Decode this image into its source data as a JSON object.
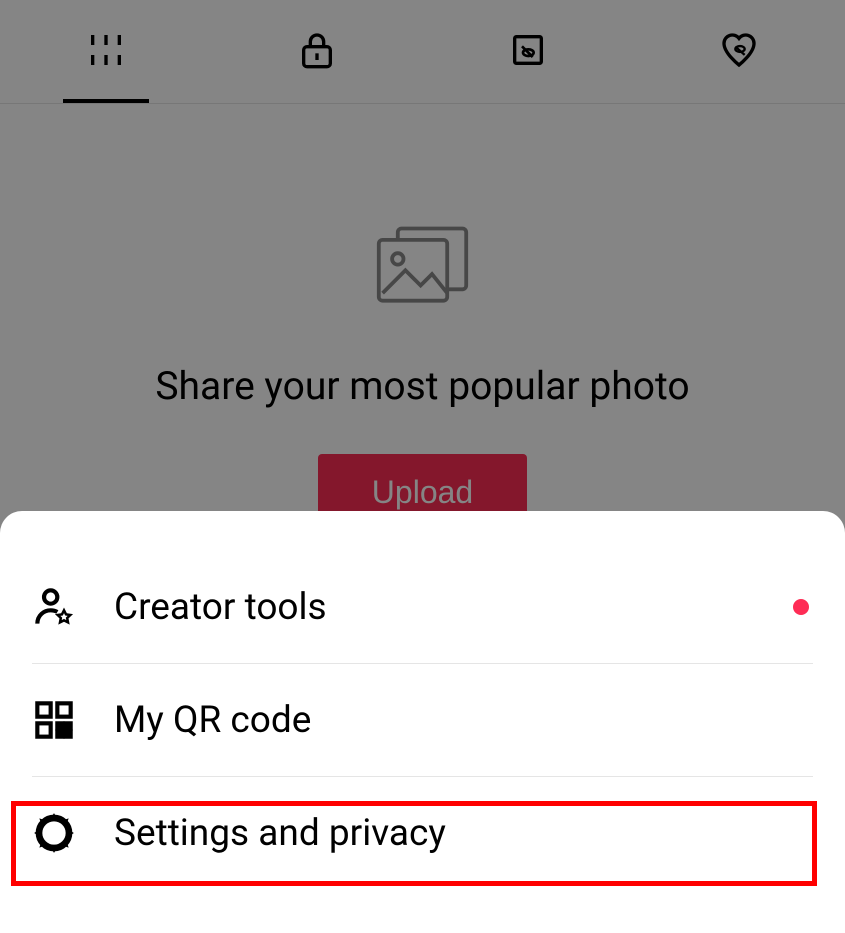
{
  "tabs": {
    "active_index": 0
  },
  "empty_state": {
    "title": "Share your most popular photo",
    "upload_label": "Upload"
  },
  "menu": {
    "items": [
      {
        "label": "Creator tools",
        "has_notification": true
      },
      {
        "label": "My QR code",
        "has_notification": false
      },
      {
        "label": "Settings and privacy",
        "has_notification": false
      }
    ]
  },
  "colors": {
    "accent": "#fe2c55",
    "highlight": "#ff0000"
  }
}
